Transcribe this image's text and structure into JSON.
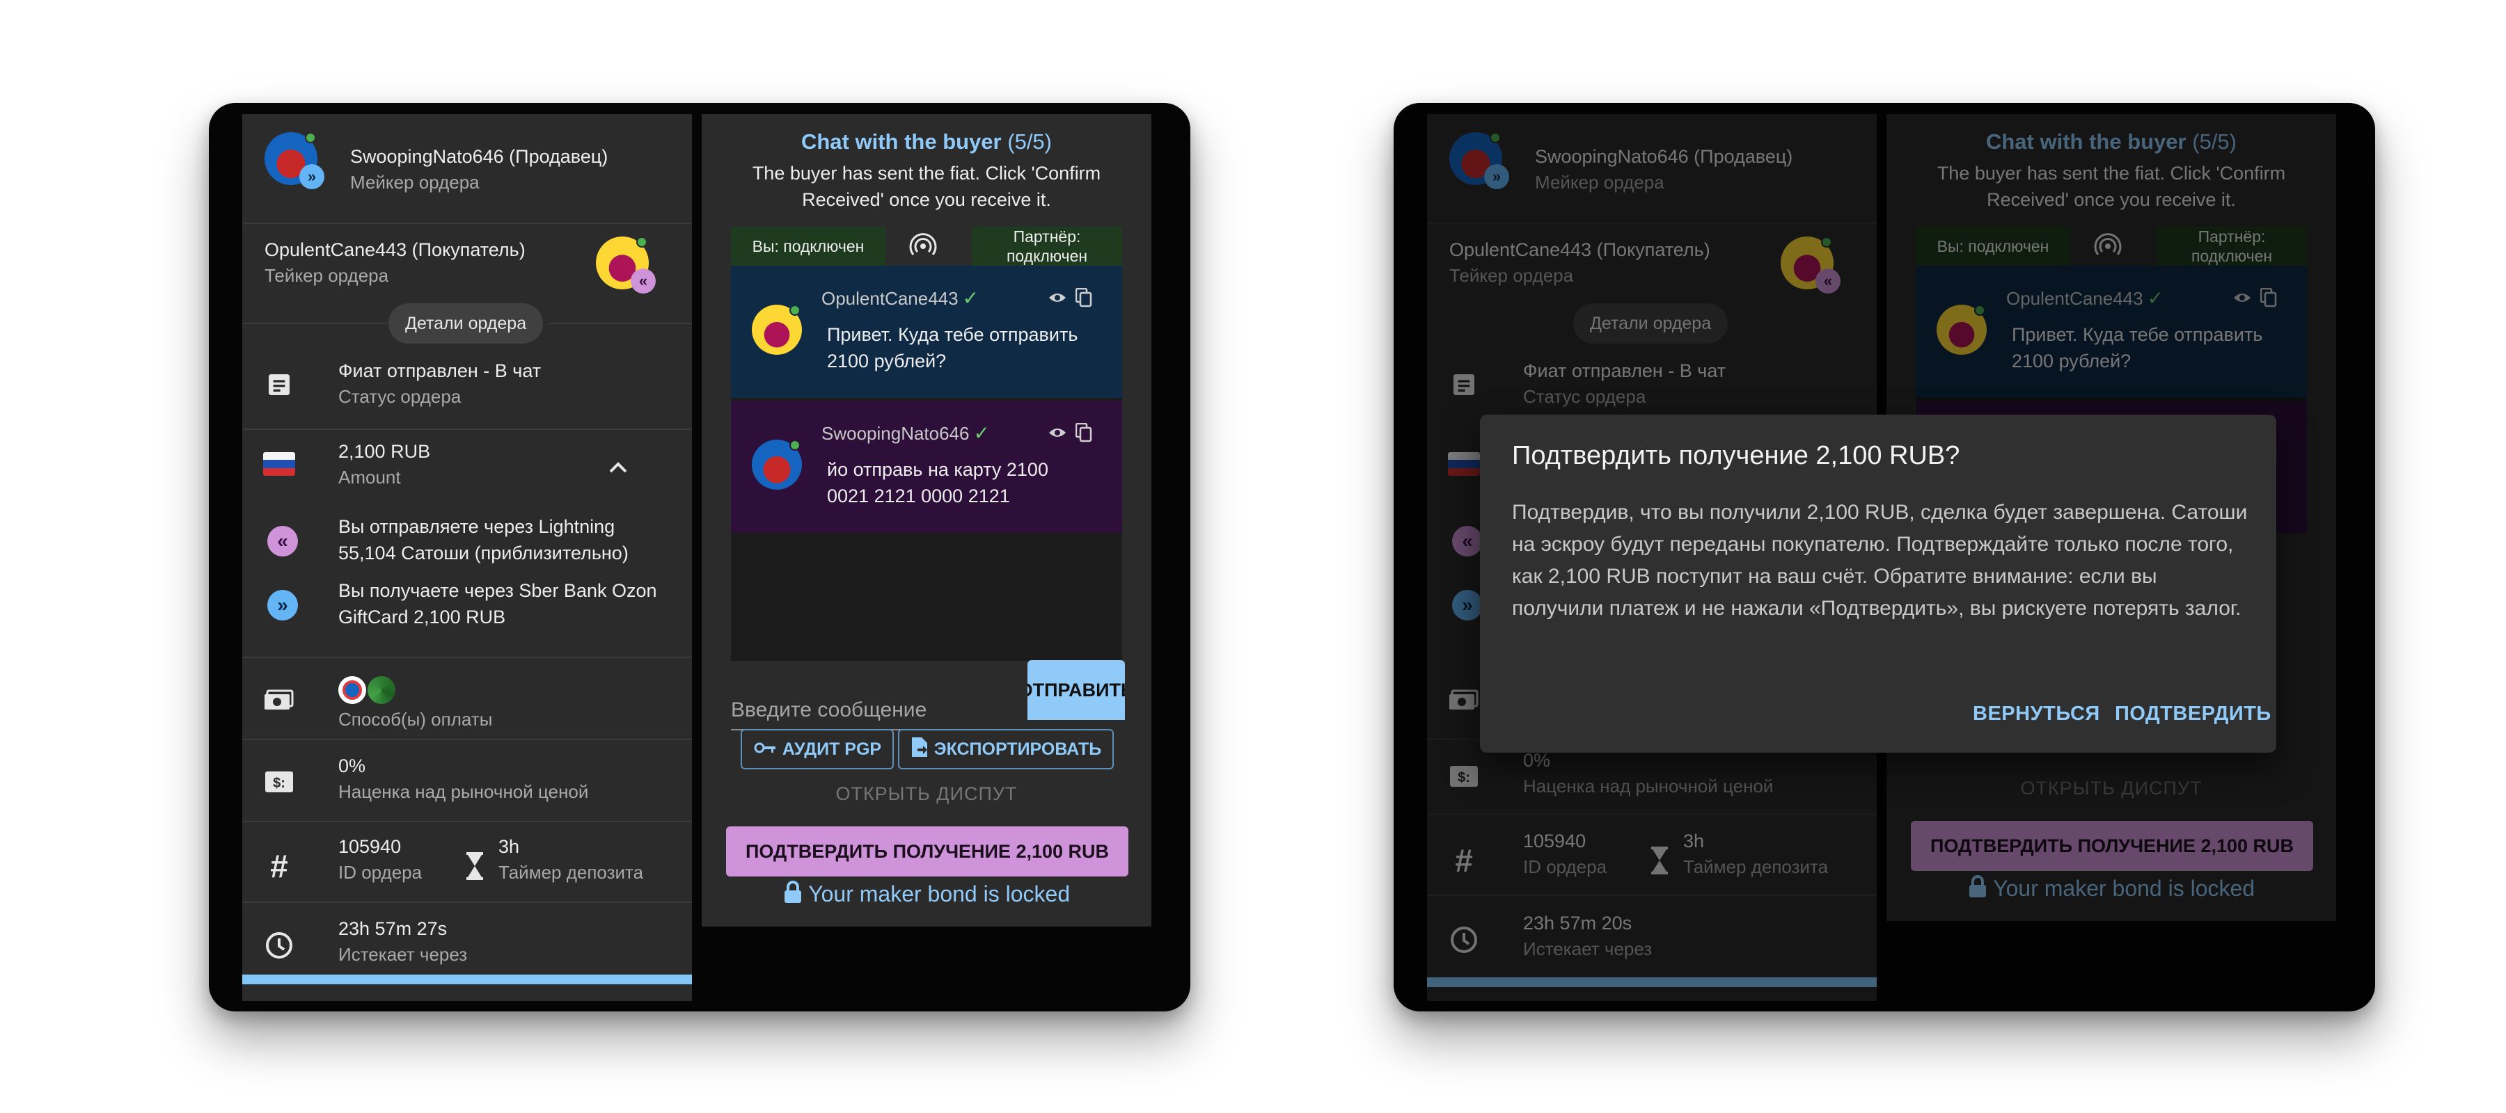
{
  "colors": {
    "accent_blue": "#90caf9",
    "confirm_purple": "#ce93d8",
    "online_green": "#4caf50",
    "buyer_msg_bg": "#0f2a45",
    "seller_msg_bg": "#2d0f3a"
  },
  "left": {
    "order": {
      "maker": {
        "name": "SwoopingNato646 (Продавец)",
        "role": "Мейкер ордера"
      },
      "taker": {
        "name": "OpulentCane443 (Покупатель)",
        "role": "Тейкер ордера"
      },
      "details_chip": "Детали ордера",
      "status": {
        "value": "Фиат отправлен - В чат",
        "label": "Статус ордера"
      },
      "amount": {
        "value": "2,100 RUB",
        "label": "Amount"
      },
      "send": "Вы отправляете через Lightning 55,104 Сатоши (приблизительно)",
      "receive": "Вы получаете через Sber Bank Ozon GiftCard 2,100 RUB",
      "payment_label": "Способ(ы) оплаты",
      "premium": {
        "value": "0%",
        "label": "Наценка над рыночной ценой"
      },
      "order_id": {
        "value": "105940",
        "label": "ID ордера"
      },
      "timer": {
        "value": "3h",
        "label": "Таймер депозита"
      },
      "expires": {
        "value": "23h 57m 27s",
        "label": "Истекает через"
      },
      "progress_fraction": 1.0
    },
    "chat": {
      "title": "Chat with the buyer",
      "count": "(5/5)",
      "subtitle": "The buyer has sent the fiat. Click 'Confirm Received' once you receive it.",
      "you_status": "Вы: подключен",
      "partner_status": "Партнёр: подключен",
      "messages": [
        {
          "author": "OpulentCane443",
          "text": "Привет. Куда тебе отправить 2100 рублей?"
        },
        {
          "author": "SwoopingNato646",
          "text": "йо отправь на карту 2100 0021 2121 0000 2121"
        }
      ],
      "input_placeholder": "Введите сообщение",
      "send_button": "ОТПРАВИТЬ",
      "pgp_button": "АУДИТ PGP",
      "export_button": "ЭКСПОРТИРОВАТЬ",
      "dispute_button": "ОТКРЫТЬ ДИСПУТ",
      "confirm_button": "ПОДТВЕРДИТЬ ПОЛУЧЕНИЕ 2,100 RUB",
      "bond_locked": "Your maker bond is locked"
    }
  },
  "right": {
    "order": {
      "maker": {
        "name": "SwoopingNato646 (Продавец)",
        "role": "Мейкер ордера"
      },
      "taker": {
        "name": "OpulentCane443 (Покупатель)",
        "role": "Тейкер ордера"
      },
      "details_chip": "Детали ордера",
      "status": {
        "value": "Фиат отправлен - В чат",
        "label": "Статус ордера"
      },
      "premium": {
        "value": "0%",
        "label": "Наценка над рыночной ценой"
      },
      "order_id": {
        "value": "105940",
        "label": "ID ордера"
      },
      "timer": {
        "value": "3h",
        "label": "Таймер депозита"
      },
      "expires": {
        "value": "23h 57m 20s",
        "label": "Истекает через"
      }
    },
    "chat": {
      "title": "Chat with the buyer",
      "count": "(5/5)",
      "subtitle": "The buyer has sent the fiat. Click 'Confirm Received' once you receive it.",
      "you_status": "Вы: подключен",
      "partner_status": "Партнёр: подключен",
      "messages": [
        {
          "author": "OpulentCane443",
          "text": "Привет. Куда тебе отправить 2100 рублей?"
        }
      ],
      "dispute_button": "ОТКРЫТЬ ДИСПУТ",
      "confirm_button": "ПОДТВЕРДИТЬ ПОЛУЧЕНИЕ 2,100 RUB",
      "bond_locked": "Your maker bond is locked"
    },
    "dialog": {
      "title": "Подтвердить получение 2,100 RUB?",
      "body": "Подтвердив, что вы получили 2,100 RUB, сделка будет завершена. Сатоши на эскроу будут переданы покупателю. Подтверждайте только после того, как 2,100 RUB поступит на ваш счёт. Обратите внимание: если вы получили платеж и не нажали «Подтвердить», вы рискуете потерять залог.",
      "back_button": "ВЕРНУТЬСЯ",
      "confirm_button": "ПОДТВЕРДИТЬ"
    }
  }
}
